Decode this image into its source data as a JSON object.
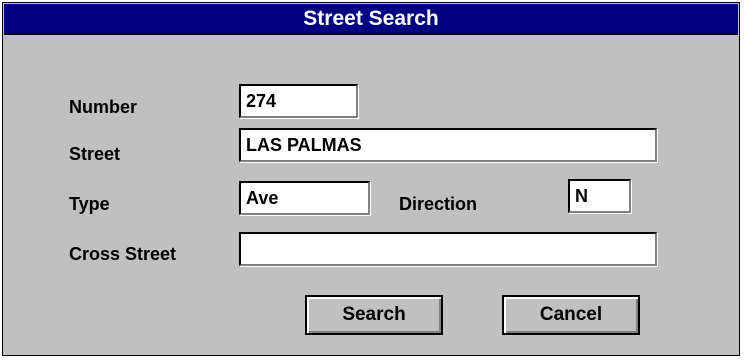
{
  "window": {
    "title": "Street Search"
  },
  "form": {
    "number_label": "Number",
    "number_value": "274",
    "street_label": "Street",
    "street_value": "LAS PALMAS",
    "type_label": "Type",
    "type_value": "Ave",
    "direction_label": "Direction",
    "direction_value": "N",
    "cross_street_label": "Cross Street",
    "cross_street_value": ""
  },
  "buttons": {
    "search_label": "Search",
    "cancel_label": "Cancel"
  },
  "colors": {
    "titlebar": "#000080",
    "dialog_bg": "#c0c0c0"
  }
}
